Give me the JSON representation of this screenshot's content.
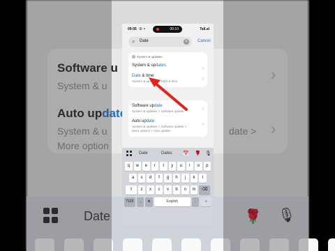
{
  "status_bar": {
    "time": "09:05",
    "pill_time": "00:10",
    "right": "Tall.al"
  },
  "search": {
    "value": "Date",
    "cancel": "Cancel"
  },
  "card1": {
    "header": "System & updates",
    "row1": {
      "title_plain": "System & up",
      "title_hl": "dates"
    },
    "row2": {
      "title_hl": "Date",
      "title_plain": " & time",
      "subtitle": "System & updates > Date & time"
    }
  },
  "card2": {
    "row1": {
      "title_plain": "Software up",
      "title_hl": "date",
      "subtitle": "System & updates > Software update"
    },
    "row2": {
      "title_plain": "Auto up",
      "title_hl": "date",
      "subtitle1": "System & updates > Software update >",
      "subtitle2": "More options > Auto update"
    }
  },
  "background": {
    "title1_plain": "Software u",
    "sub1": "System & u",
    "title2_plain": "Auto up",
    "title2_hl": "date",
    "sub2": "System & u",
    "sub2b": "date >",
    "sub3": "More option",
    "kb_word": "Date"
  },
  "keyboard": {
    "suggestions": [
      "Date",
      "Dates"
    ],
    "row1": [
      "q",
      "w",
      "e",
      "r",
      "t",
      "y",
      "u",
      "i",
      "o",
      "p"
    ],
    "row2": [
      "a",
      "s",
      "d",
      "f",
      "g",
      "h",
      "j",
      "k",
      "l"
    ],
    "row3": [
      "z",
      "x",
      "c",
      "v",
      "b",
      "n",
      "m"
    ],
    "num_key": "?123",
    "space": "English",
    "comma": ",",
    "period": "."
  },
  "colors": {
    "accent": "#1f6fd1",
    "arrow": "#e8201a"
  }
}
